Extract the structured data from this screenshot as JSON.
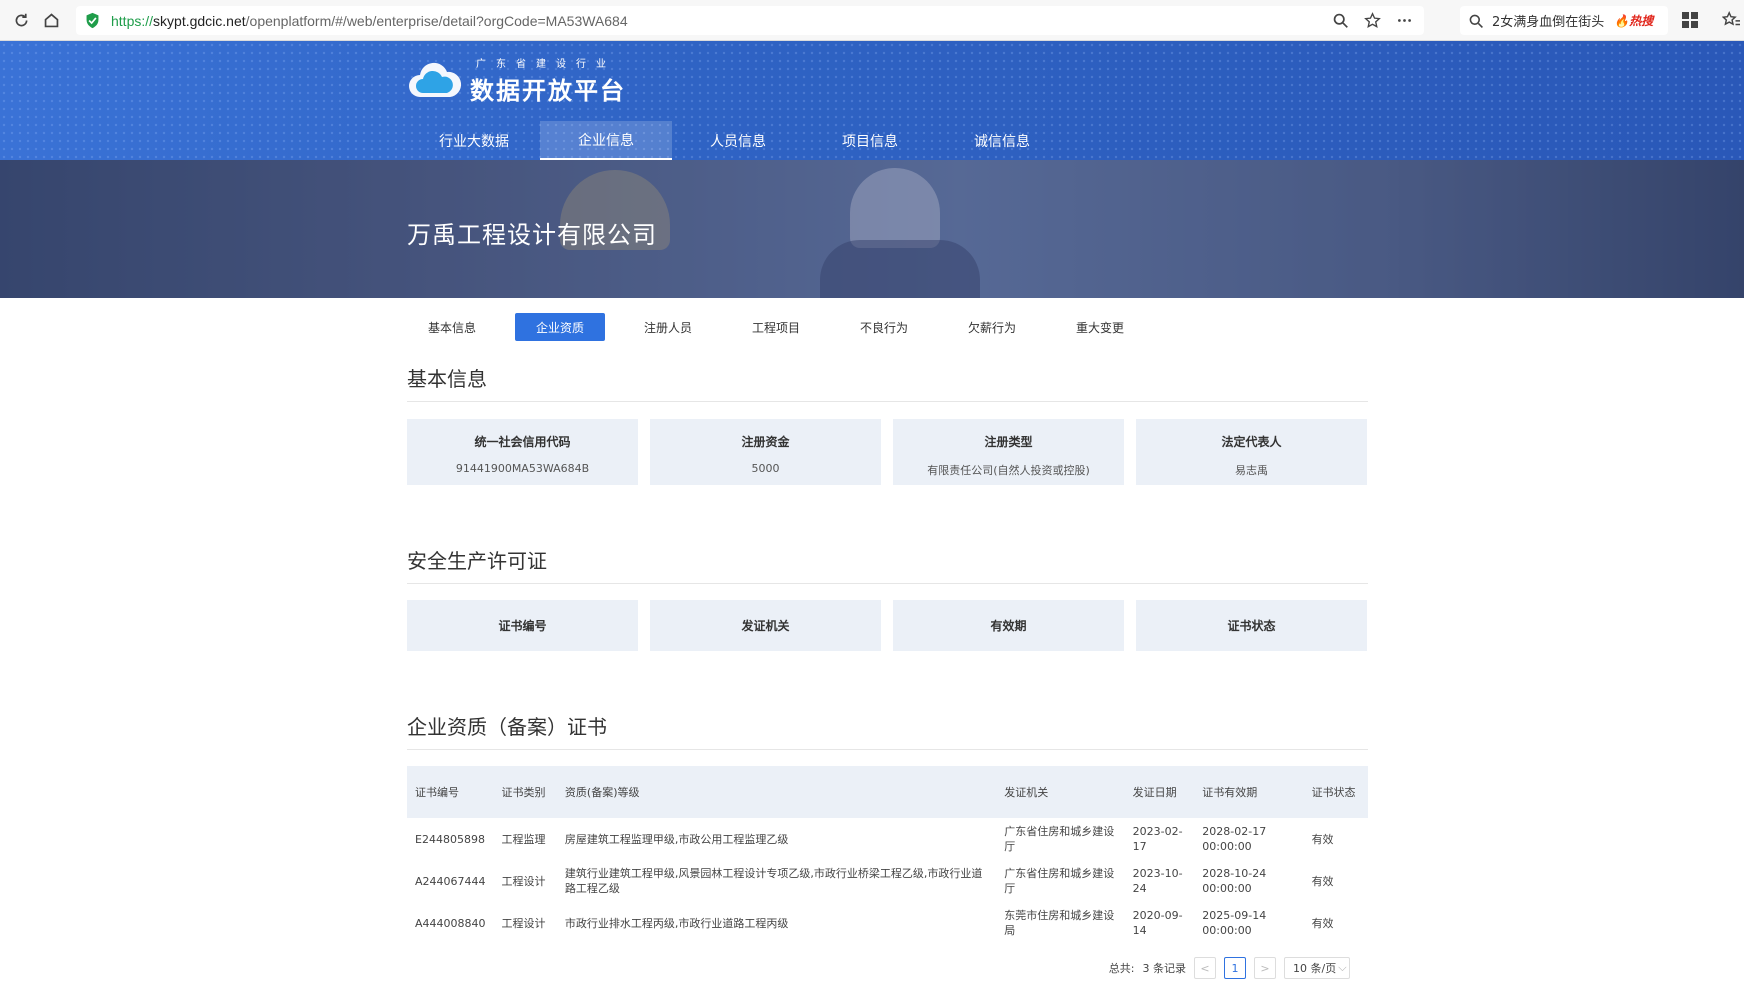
{
  "browser": {
    "url_proto": "https://",
    "url_host": "skypt.gdcic.net",
    "url_path": "/openplatform/#/web/enterprise/detail?orgCode=MA53WA684",
    "hot_search_text": "2女满身血倒在街头",
    "hot_search_badge": "热搜"
  },
  "site": {
    "logo_subtitle": "广东省建设行业",
    "logo_title": "数据开放平台",
    "nav": [
      "行业大数据",
      "企业信息",
      "人员信息",
      "项目信息",
      "诚信信息"
    ],
    "nav_active": 1
  },
  "company": {
    "name": "万禹工程设计有限公司"
  },
  "tabs": {
    "items": [
      "基本信息",
      "企业资质",
      "注册人员",
      "工程项目",
      "不良行为",
      "欠薪行为",
      "重大变更"
    ],
    "active": 1
  },
  "basic_info": {
    "title": "基本信息",
    "fields": [
      {
        "label": "统一社会信用代码",
        "value": "91441900MA53WA684B"
      },
      {
        "label": "注册资金",
        "value": "5000"
      },
      {
        "label": "注册类型",
        "value": "有限责任公司(自然人投资或控股)"
      },
      {
        "label": "法定代表人",
        "value": "易志禹"
      }
    ]
  },
  "safety_license": {
    "title": "安全生产许可证",
    "columns": [
      "证书编号",
      "发证机关",
      "有效期",
      "证书状态"
    ]
  },
  "qualification": {
    "title": "企业资质（备案）证书",
    "headers": [
      "证书编号",
      "证书类别",
      "资质(备案)等级",
      "发证机关",
      "发证日期",
      "证书有效期",
      "证书状态"
    ],
    "rows": [
      [
        "E244805898",
        "工程监理",
        "房屋建筑工程监理甲级,市政公用工程监理乙级",
        "广东省住房和城乡建设厅",
        "2023-02-17",
        "2028-02-17 00:00:00",
        "有效"
      ],
      [
        "A244067444",
        "工程设计",
        "建筑行业建筑工程甲级,风景园林工程设计专项乙级,市政行业桥梁工程乙级,市政行业道路工程乙级",
        "广东省住房和城乡建设厅",
        "2023-10-24",
        "2028-10-24 00:00:00",
        "有效"
      ],
      [
        "A444008840",
        "工程设计",
        "市政行业排水工程丙级,市政行业道路工程丙级",
        "东莞市住房和城乡建设局",
        "2020-09-14",
        "2025-09-14 00:00:00",
        "有效"
      ]
    ]
  },
  "pager": {
    "total_label": "总共:",
    "total_value": "3 条记录",
    "prev": "<",
    "current": "1",
    "next": ">",
    "page_size": "10 条/页"
  },
  "colors": {
    "primary": "#2f72e0",
    "header": "#2f63c4",
    "card_bg": "#ebf0f7"
  }
}
